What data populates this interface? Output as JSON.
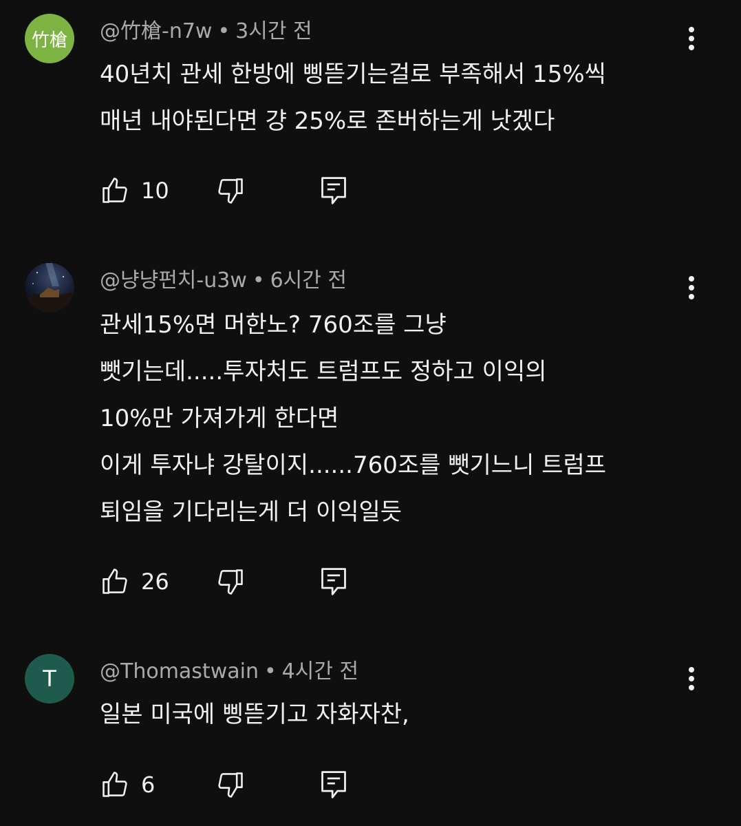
{
  "comments": [
    {
      "avatar_text": "竹槍",
      "avatar_color": "#7cb342",
      "author": "@竹槍-n7w",
      "separator": "•",
      "time": "3시간 전",
      "lines": [
        "40년치 관세 한방에 삥뜯기는걸로 부족해서 15%씩",
        "매년 내야된다면 걍 25%로 존버하는게 낫겠다"
      ],
      "likes": "10",
      "icons": {
        "like": "thumbs-up-icon",
        "dislike": "thumbs-down-icon",
        "reply": "reply-icon",
        "more": "more-vertical-icon"
      }
    },
    {
      "avatar_text": "",
      "avatar_image": "night-sky-photo",
      "author": "@냥냥펀치-u3w",
      "separator": "•",
      "time": "6시간 전",
      "lines": [
        "관세15%면 머한노? 760조를 그냥",
        "뺏기는데.....투자처도 트럼프도 정하고 이익의",
        "10%만 가져가게 한다면",
        "이게 투자냐 강탈이지......760조를 뺏기느니 트럼프",
        "퇴임을 기다리는게 더 이익일듯"
      ],
      "likes": "26",
      "icons": {
        "like": "thumbs-up-icon",
        "dislike": "thumbs-down-icon",
        "reply": "reply-icon",
        "more": "more-vertical-icon"
      }
    },
    {
      "avatar_text": "T",
      "avatar_color": "#1e5b4c",
      "author": "@Thomastwain",
      "separator": "•",
      "time": "4시간 전",
      "lines": [
        "일본 미국에 삥뜯기고 자화자찬,"
      ],
      "likes": "6",
      "icons": {
        "like": "thumbs-up-icon",
        "dislike": "thumbs-down-icon",
        "reply": "reply-icon",
        "more": "more-vertical-icon"
      }
    }
  ],
  "colors": {
    "background": "#0f0f0f",
    "text": "#f1f1f1",
    "meta": "#aaaaaa"
  }
}
